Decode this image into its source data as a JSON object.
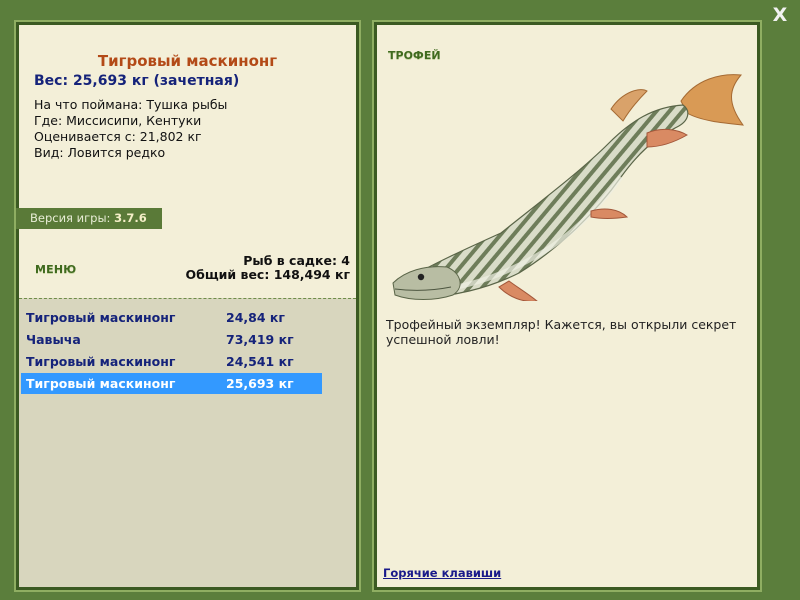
{
  "window": {
    "close_label": "X"
  },
  "left": {
    "title": "Тигровый маскинонг",
    "weight": "Вес: 25,693 кг (зачетная)",
    "details": {
      "bait": "На что поймана: Тушка рыбы",
      "where": "Где: Миссисипи, Кентуки",
      "valued": "Оценивается с: 21,802 кг",
      "kind": "Вид: Ловится редко"
    },
    "version_label": "Версия игры:",
    "version_value": "3.7.6",
    "menu_label": "МЕНЮ",
    "summary": {
      "fish_in_keepnet": "Рыб в садке: 4",
      "total_weight": "Общий вес: 148,494 кг"
    },
    "catch_list": [
      {
        "name": "Тигровый маскинонг",
        "weight": "24,84 кг",
        "selected": false
      },
      {
        "name": "Чавыча",
        "weight": "73,419 кг",
        "selected": false
      },
      {
        "name": "Тигровый маскинонг",
        "weight": "24,541 кг",
        "selected": false
      },
      {
        "name": "Тигровый маскинонг",
        "weight": "25,693 кг",
        "selected": true
      }
    ]
  },
  "right": {
    "trophy_label": "ТРОФЕЙ",
    "trophy_text": "Трофейный экземпляр! Кажется, вы открыли секрет успешной ловли!",
    "hotkeys_label": "Горячие клавиши",
    "fish_icon": "tiger-muskellunge-illustration"
  },
  "colors": {
    "frame": "#5b7e3c",
    "panel": "#f3efd8",
    "list_bg": "#d8d6be",
    "title": "#b34a17",
    "navy": "#15237a",
    "selection": "#3399ff"
  }
}
